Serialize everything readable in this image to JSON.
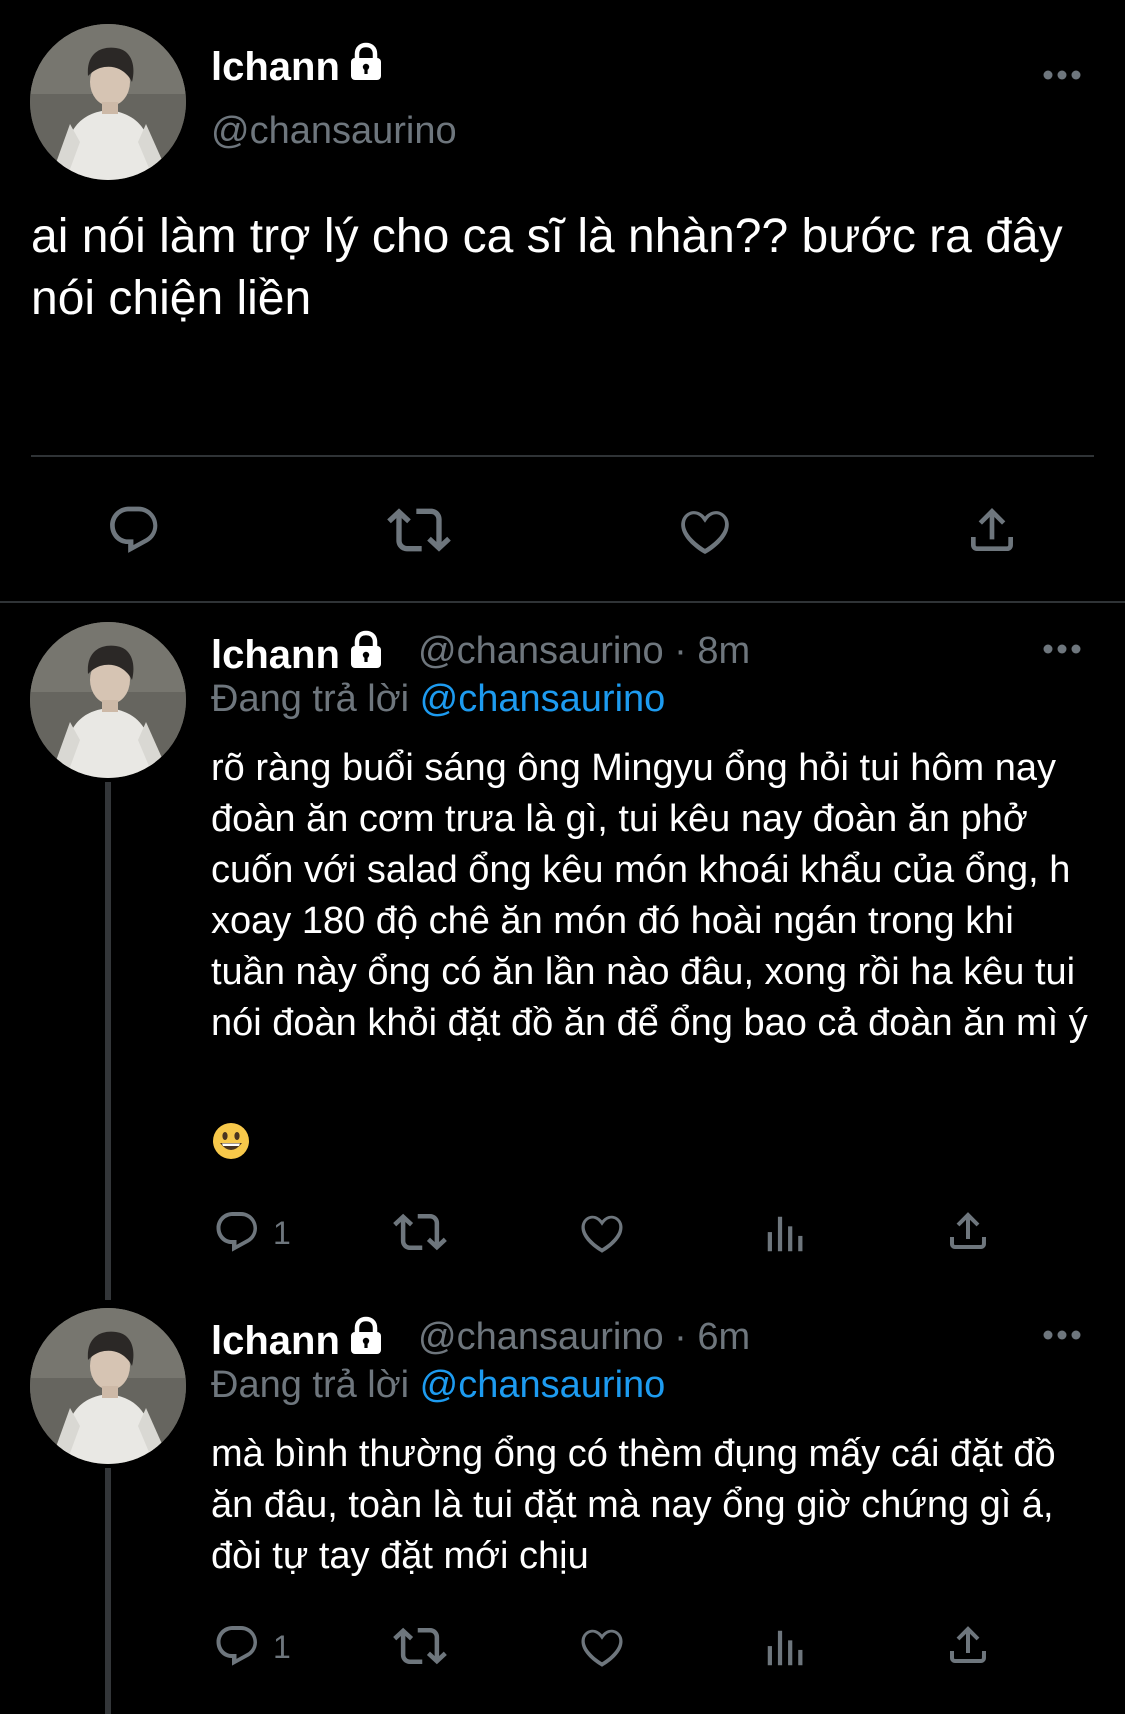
{
  "main_tweet": {
    "display_name": "lchann",
    "handle": "@chansaurino",
    "text": "ai nói làm trợ lý cho ca sĩ là nhàn?? bước ra đây nói chiện liền"
  },
  "replies": [
    {
      "display_name": "lchann",
      "handle_meta": "@chansaurino · 8m",
      "reply_prefix": "Đang trả lời",
      "reply_target": "@chansaurino",
      "text": "rõ ràng buổi sáng ông Mingyu ổng hỏi tui hôm nay đoàn ăn cơm trưa là gì, tui kêu nay đoàn ăn phở cuốn với salad ổng kêu món khoái khẩu của ổng, h xoay 180 độ chê ăn món đó hoài ngán trong khi tuần này ổng có ăn lần nào đâu, xong rồi ha kêu tui nói đoàn khỏi đặt đồ ăn để ổng bao cả đoàn ăn mì ý",
      "emoji": "grinning-face",
      "reply_count": "1"
    },
    {
      "display_name": "lchann",
      "handle_meta": "@chansaurino · 6m",
      "reply_prefix": "Đang trả lời",
      "reply_target": "@chansaurino",
      "text": "mà bình thường ổng có thèm đụng mấy cái đặt đồ ăn đâu, toàn là tui đặt mà nay ổng giờ chứng gì á, đòi tự tay đặt mới chịu",
      "reply_count": "1"
    }
  ],
  "colors": {
    "background": "#000000",
    "secondary_text": "#6e767d",
    "mention": "#1d9bf0",
    "divider": "#2f3336"
  }
}
